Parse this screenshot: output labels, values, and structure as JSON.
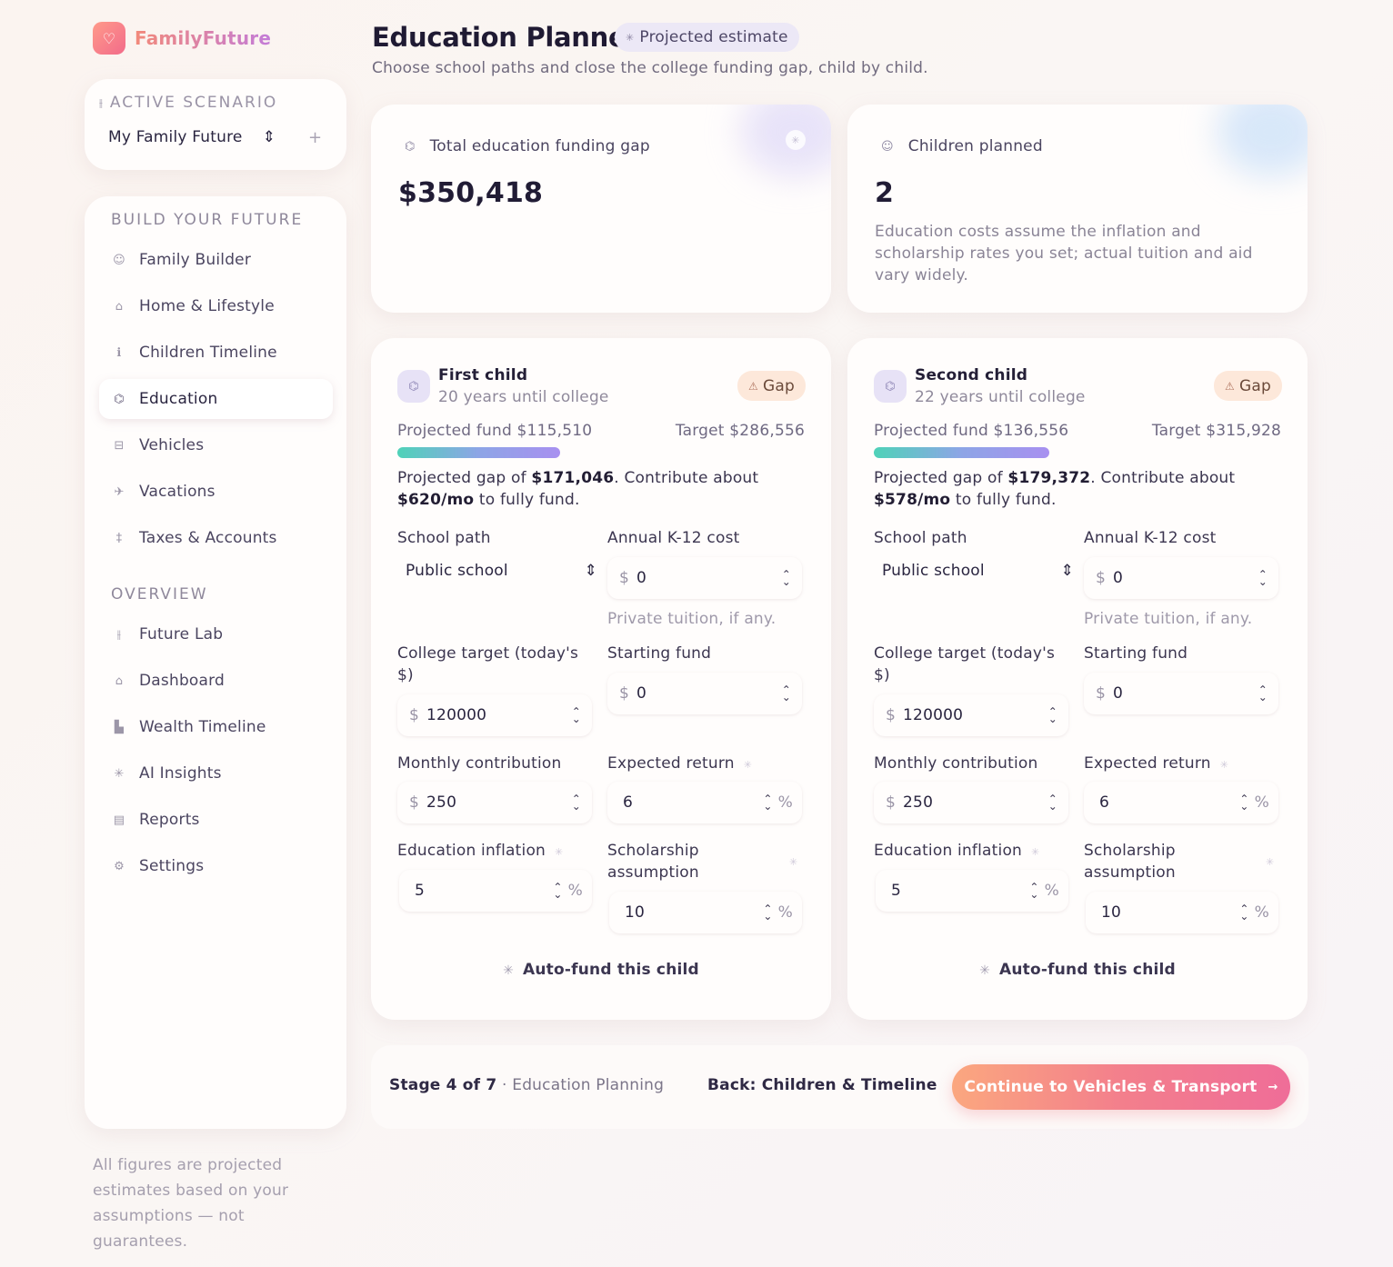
{
  "brand": {
    "name": "FamilyFuture",
    "logo_icon": "heart-icon"
  },
  "scenario": {
    "label": "ACTIVE SCENARIO",
    "selected": "My Family Future"
  },
  "nav": {
    "section1": "BUILD YOUR FUTURE",
    "section2": "OVERVIEW",
    "items": [
      {
        "label": "Family Builder",
        "icon": "users-icon"
      },
      {
        "label": "Home & Lifestyle",
        "icon": "home-icon"
      },
      {
        "label": "Children Timeline",
        "icon": "child-icon"
      },
      {
        "label": "Education",
        "icon": "graduation-cap-icon"
      },
      {
        "label": "Vehicles",
        "icon": "car-icon"
      },
      {
        "label": "Vacations",
        "icon": "plane-icon"
      },
      {
        "label": "Taxes & Accounts",
        "icon": "tax-icon"
      },
      {
        "label": "Future Lab",
        "icon": "sliders-icon"
      },
      {
        "label": "Dashboard",
        "icon": "house-icon"
      },
      {
        "label": "Wealth Timeline",
        "icon": "bar-chart-icon"
      },
      {
        "label": "AI Insights",
        "icon": "sparkle-icon"
      },
      {
        "label": "Reports",
        "icon": "document-icon"
      },
      {
        "label": "Settings",
        "icon": "gear-icon"
      }
    ]
  },
  "footnote": "All figures are projected estimates based on your assumptions — not guarantees.",
  "header": {
    "title": "Education Planner",
    "badge": "Projected estimate",
    "subtitle": "Choose school paths and close the college funding gap, child by child."
  },
  "summary": {
    "gap_label": "Total education funding gap",
    "gap_value": "$350,418",
    "children_label": "Children planned",
    "children_value": "2",
    "children_note": "Education costs assume the inflation and scholarship rates you set; actual tuition and aid vary widely."
  },
  "labels": {
    "school_path": "School path",
    "k12_cost": "Annual K-12 cost",
    "k12_hint": "Private tuition, if any.",
    "college_target": "College target (today's $)",
    "starting_fund": "Starting fund",
    "monthly": "Monthly contribution",
    "return": "Expected return",
    "inflation": "Education inflation",
    "scholarship": "Scholarship assumption",
    "autofund": "Auto-fund this child",
    "gap_badge": "Gap",
    "currency": "$",
    "percent": "%",
    "msg_prefix": "Projected gap of ",
    "msg_mid": ". Contribute about ",
    "msg_suffix": " to fully fund."
  },
  "children": [
    {
      "name": "First child",
      "years": "20 years until college",
      "projected": "Projected fund $115,510",
      "target": "Target $286,556",
      "funded_fraction": 0.4,
      "gap": "$171,046",
      "monthly_needed": "$620/mo",
      "school_path": "Public school",
      "k12_cost": "0",
      "college_target": "120000",
      "starting_fund": "0",
      "monthly": "250",
      "return": "6",
      "inflation": "5",
      "scholarship": "10"
    },
    {
      "name": "Second child",
      "years": "22 years until college",
      "projected": "Projected fund $136,556",
      "target": "Target $315,928",
      "funded_fraction": 0.43,
      "gap": "$179,372",
      "monthly_needed": "$578/mo",
      "school_path": "Public school",
      "k12_cost": "0",
      "college_target": "120000",
      "starting_fund": "0",
      "monthly": "250",
      "return": "6",
      "inflation": "5",
      "scholarship": "10"
    }
  ],
  "footer": {
    "stage": "Stage 4 of 7",
    "stage_name": "· Education Planning",
    "back": "Back: Children & Timeline",
    "continue": "Continue to Vehicles & Transport"
  }
}
